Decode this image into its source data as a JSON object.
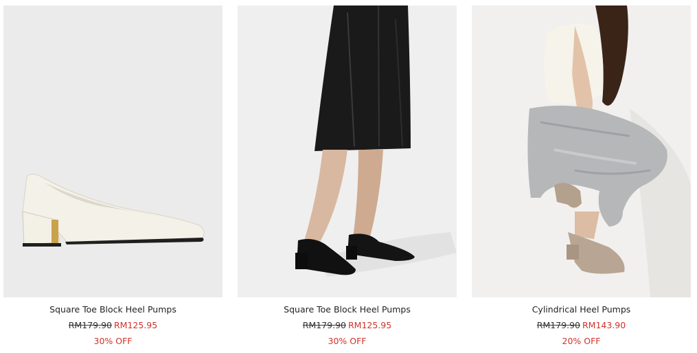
{
  "products": [
    {
      "name": "Square Toe Block Heel Pumps",
      "price_original": "RM179.90",
      "price_sale": "RM125.95",
      "discount": "30% OFF"
    },
    {
      "name": "Square Toe Block Heel Pumps",
      "price_original": "RM179.90",
      "price_sale": "RM125.95",
      "discount": "30% OFF"
    },
    {
      "name": "Cylindrical Heel Pumps",
      "price_original": "RM179.90",
      "price_sale": "RM143.90",
      "discount": "20% OFF"
    }
  ],
  "colors": {
    "sale_red": "#d0312d",
    "text_dark": "#222222",
    "image_bg": "#ececec"
  }
}
